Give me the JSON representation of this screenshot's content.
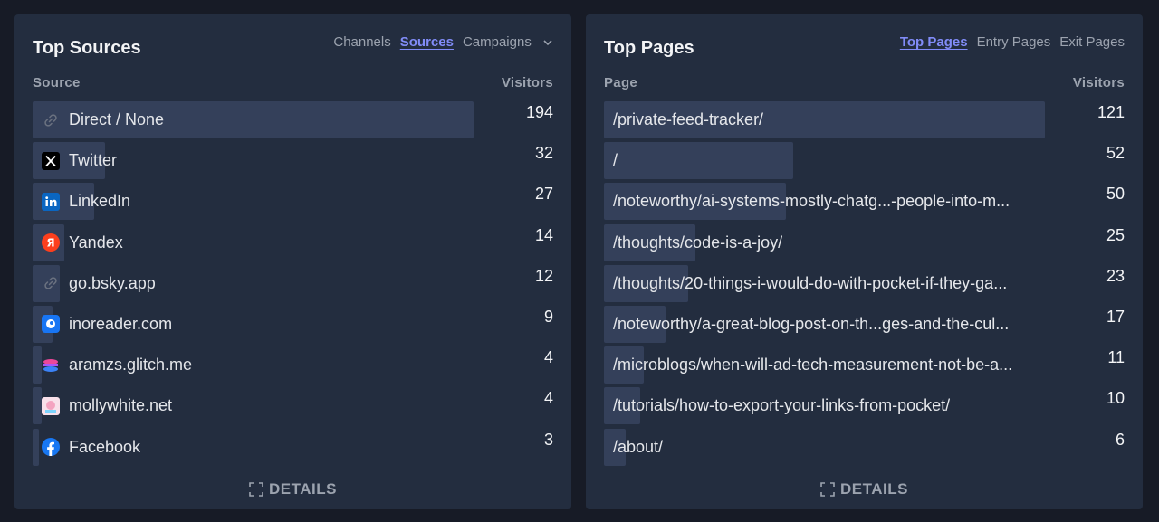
{
  "sources": {
    "title": "Top Sources",
    "tabs": [
      "Channels",
      "Sources",
      "Campaigns"
    ],
    "col_left": "Source",
    "col_right": "Visitors",
    "rows": [
      {
        "label": "Direct / None",
        "value": "194",
        "icon": "link-icon",
        "ratio": 1.0
      },
      {
        "label": "Twitter",
        "value": "32",
        "icon": "x-logo-icon",
        "ratio": 0.165
      },
      {
        "label": "LinkedIn",
        "value": "27",
        "icon": "linkedin-icon",
        "ratio": 0.139
      },
      {
        "label": "Yandex",
        "value": "14",
        "icon": "yandex-icon",
        "ratio": 0.072
      },
      {
        "label": "go.bsky.app",
        "value": "12",
        "icon": "link-icon",
        "ratio": 0.062
      },
      {
        "label": "inoreader.com",
        "value": "9",
        "icon": "inoreader-icon",
        "ratio": 0.046
      },
      {
        "label": "aramzs.glitch.me",
        "value": "4",
        "icon": "glitch-icon",
        "ratio": 0.021
      },
      {
        "label": "mollywhite.net",
        "value": "4",
        "icon": "mollywhite-icon",
        "ratio": 0.021
      },
      {
        "label": "Facebook",
        "value": "3",
        "icon": "facebook-icon",
        "ratio": 0.015
      }
    ],
    "details": "DETAILS"
  },
  "pages": {
    "title": "Top Pages",
    "tabs": [
      "Top Pages",
      "Entry Pages",
      "Exit Pages"
    ],
    "col_left": "Page",
    "col_right": "Visitors",
    "rows": [
      {
        "label": "/private-feed-tracker/",
        "value": "121",
        "ratio": 1.0
      },
      {
        "label": "/",
        "value": "52",
        "ratio": 0.43
      },
      {
        "label": "/noteworthy/ai-systems-mostly-chatg...-people-into-m...",
        "value": "50",
        "ratio": 0.413
      },
      {
        "label": "/thoughts/code-is-a-joy/",
        "value": "25",
        "ratio": 0.207
      },
      {
        "label": "/thoughts/20-things-i-would-do-with-pocket-if-they-ga...",
        "value": "23",
        "ratio": 0.19
      },
      {
        "label": "/noteworthy/a-great-blog-post-on-th...ges-and-the-cul...",
        "value": "17",
        "ratio": 0.14
      },
      {
        "label": "/microblogs/when-will-ad-tech-measurement-not-be-a...",
        "value": "11",
        "ratio": 0.091
      },
      {
        "label": "/tutorials/how-to-export-your-links-from-pocket/",
        "value": "10",
        "ratio": 0.083
      },
      {
        "label": "/about/",
        "value": "6",
        "ratio": 0.05
      }
    ],
    "details": "DETAILS"
  },
  "colors": {
    "accent": "#818cf8",
    "panel": "#232d3f",
    "bar": "#34405a",
    "background": "#171b26"
  }
}
